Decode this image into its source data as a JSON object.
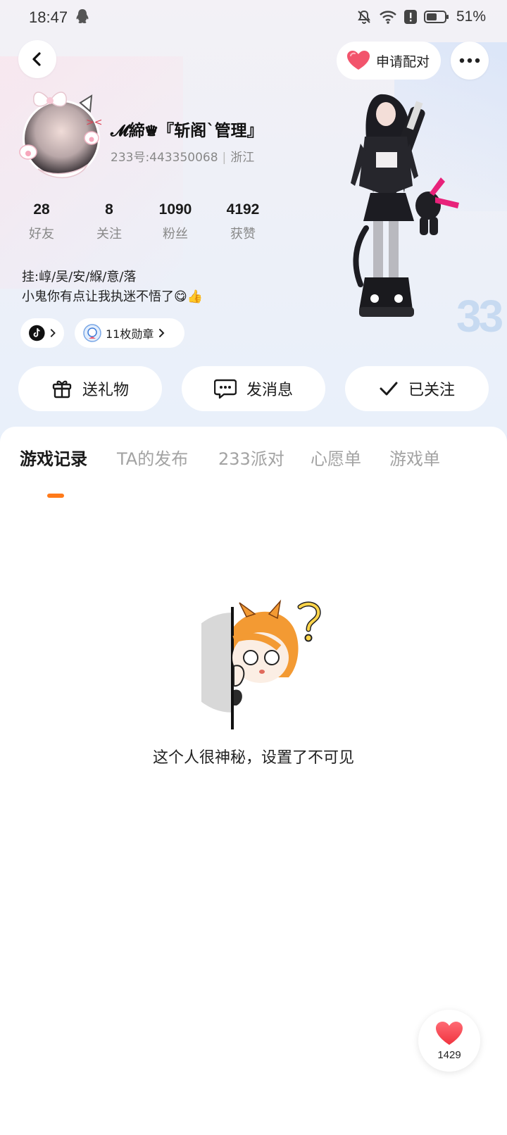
{
  "status_bar": {
    "time": "18:47",
    "battery": "51%",
    "icons": [
      "qq-icon",
      "bell-muted-icon",
      "wifi-icon",
      "alert-icon",
      "battery-icon"
    ]
  },
  "header": {
    "back_icon": "chevron-left-icon",
    "pair_label": "申请配对",
    "more_icon": "more-dots-icon"
  },
  "profile": {
    "name": "𝓜締♛『斩阁`管理』",
    "uid": "233号:443350068",
    "location": "浙江",
    "stats": [
      {
        "value": "28",
        "label": "好友"
      },
      {
        "value": "8",
        "label": "关注"
      },
      {
        "value": "1090",
        "label": "粉丝"
      },
      {
        "value": "4192",
        "label": "获赞"
      }
    ],
    "bio_line1": "挂:崞/吴/安/緥/意/落",
    "bio_line2": "小鬼你有点让我执迷不悟了😋👍",
    "badges_label": "11枚勋章",
    "decor_text": "33"
  },
  "actions": {
    "gift": "送礼物",
    "message": "发消息",
    "followed": "已关注"
  },
  "tabs": [
    "游戏记录",
    "TA的发布",
    "233派对",
    "心愿单",
    "游戏单"
  ],
  "active_tab": 0,
  "empty_state": {
    "text": "这个人很神秘，设置了不可见"
  },
  "like": {
    "count": "1429"
  },
  "colors": {
    "accent": "#ff7a1a",
    "heart": "#f2546c",
    "muted": "#a3a3a3"
  }
}
